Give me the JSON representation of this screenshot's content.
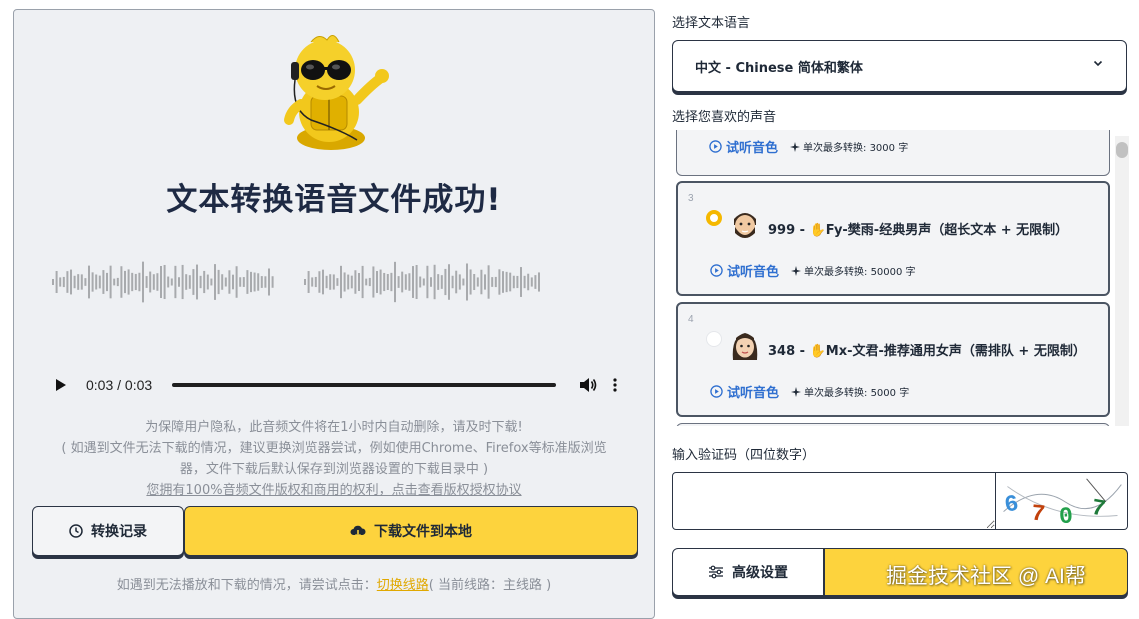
{
  "result": {
    "title": "文本转换语音文件成功!",
    "player": {
      "time": "0:03 / 0:03",
      "progress": 1.0
    },
    "notice": {
      "line1": "为保障用户隐私，此音频文件将在1小时内自动删除，请及时下载!",
      "line2": "( 如遇到文件无法下载的情况，建议更换浏览器尝试，例如使用Chrome、Firefox等标准版浏览",
      "line3": "器，文件下载后默认保存到浏览器设置的下载目录中 )",
      "line4": "您拥有100%音频文件版权和商用的权利，点击查看版权授权协议"
    },
    "buttons": {
      "history": "转换记录",
      "download": "下载文件到本地"
    },
    "route_tip": {
      "prefix": "如遇到无法播放和下载的情况，请尝试点击：",
      "link": "切换线路",
      "suffix": "( 当前线路：主线路 )"
    }
  },
  "settings": {
    "language_label": "选择文本语言",
    "language_value": "中文 - Chinese 简体和繁体",
    "voice_label": "选择您喜欢的声音",
    "voices": [
      {
        "num": "",
        "name": "",
        "listen": "试听音色",
        "limit": "单次最多转换: 3000 字",
        "selected": false
      },
      {
        "num": "3",
        "name": "999 - ✋Fy-樊雨-经典男声（超长文本 + 无限制）",
        "listen": "试听音色",
        "limit": "单次最多转换: 50000 字",
        "selected": true
      },
      {
        "num": "4",
        "name": "348 - ✋Mx-文君-推荐通用女声（需排队 + 无限制）",
        "listen": "试听音色",
        "limit": "单次最多转换: 5000 字",
        "selected": false
      }
    ],
    "captcha_label": "输入验证码（四位数字）",
    "captcha_input_value": "",
    "captcha_digits": [
      "6",
      "7",
      "0",
      "7"
    ],
    "captcha_colors": [
      "#3a8fd9",
      "#c2410c",
      "#22a04b",
      "#1f7a3a"
    ],
    "advanced_label": "高级设置"
  },
  "watermark": "掘金技术社区 @ AI帮",
  "colors": {
    "accent_yellow": "#fdd33d",
    "link_blue": "#2f6fd0",
    "panel_bg": "#eef0f3",
    "dark_border": "#2b3444"
  }
}
